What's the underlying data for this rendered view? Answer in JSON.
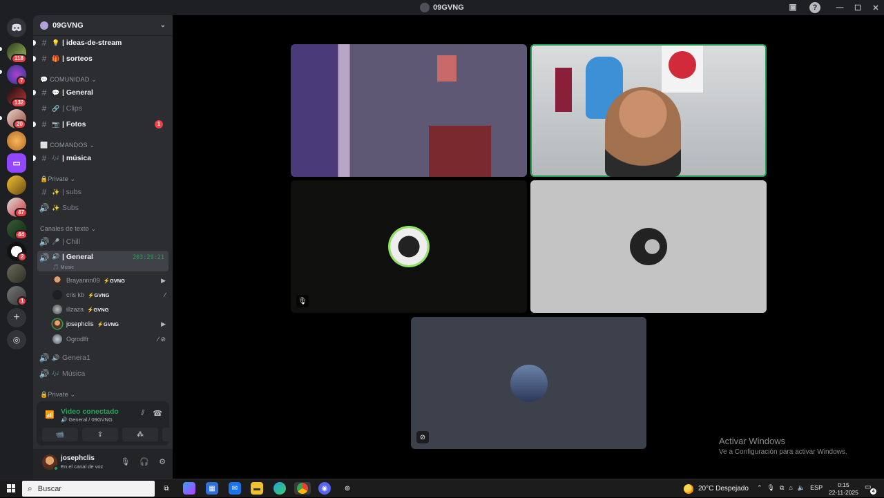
{
  "window": {
    "title": "09GVNG",
    "minimize": "—",
    "maximize": "☐",
    "close": "✕"
  },
  "server": {
    "name": "09GVNG",
    "chevron": "⌄"
  },
  "rail": {
    "badges": [
      "118",
      "7",
      "132",
      "20",
      "47",
      "44",
      "2",
      "1"
    ],
    "twitch_label": "Twitch"
  },
  "channels": {
    "top": [
      {
        "emoji": "💡",
        "name": "| ideas-de-stream"
      },
      {
        "emoji": "🎁",
        "name": "| sorteos"
      }
    ],
    "cat_comunidad": "💬 COMUNIDAD ⌄",
    "comunidad": [
      {
        "emoji": "💬",
        "name": "| General"
      },
      {
        "emoji": "🔗",
        "name": "| Clips"
      },
      {
        "emoji": "📷",
        "name": "| Fotos",
        "badge": "1"
      }
    ],
    "cat_comandos": "⬜ COMANDOS ⌄",
    "comandos": [
      {
        "emoji": "🎶",
        "name": "| música"
      }
    ],
    "cat_private": "🔒Private ⌄",
    "private": [
      {
        "emoji": "✨",
        "name": "| subs"
      },
      {
        "emoji": "✨",
        "name": "Subs"
      }
    ],
    "cat_texto": "Canales de texto ⌄",
    "texto": [
      {
        "emoji": "🎤",
        "name": "| Chill"
      },
      {
        "emoji": "🔊",
        "name": "| General",
        "timer": "203:29:21",
        "sub": "🎵 Music"
      }
    ],
    "members": [
      {
        "name": "Brayannn09",
        "tag": "⚡GVNG",
        "icons": "▶"
      },
      {
        "name": "cris kb",
        "tag": "⚡GVNG",
        "icons": "⁄"
      },
      {
        "name": "illzaza",
        "tag": "⚡GVNG",
        "icons": ""
      },
      {
        "name": "josephclis",
        "tag": "⚡GVNG",
        "icons": "▶"
      },
      {
        "name": "Ogrodlfr",
        "tag": "",
        "icons": "⁄ ⊘"
      }
    ],
    "after": [
      {
        "emoji": "🔊",
        "name": "Genera1"
      },
      {
        "emoji": "🎶",
        "name": "Música"
      }
    ],
    "cat_private2": "🔒Private ⌄"
  },
  "voice": {
    "status": "Video conectado",
    "location": "🔊 General / 09GVNG",
    "buttons": [
      "📹",
      "⇪",
      "⁂",
      "✧"
    ]
  },
  "user": {
    "name": "josephclis",
    "status": "En el canal de voz"
  },
  "watermark": {
    "line1": "Activar Windows",
    "line2": "Ve a Configuración para activar Windows."
  },
  "taskbar": {
    "search_placeholder": "Buscar",
    "weather": "20°C  Despejado",
    "lang": "ESP",
    "time": "0:15",
    "date": "22-11-2025",
    "notifications": "4"
  },
  "colors": {
    "accent": "#23a559",
    "danger": "#f23f43",
    "bg": "#1e1f22",
    "panel": "#2b2d31"
  }
}
